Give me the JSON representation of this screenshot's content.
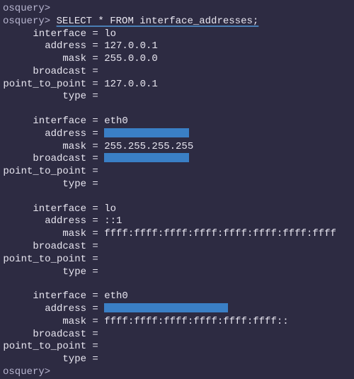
{
  "prompt": "osquery>",
  "query": "SELECT * FROM interface_addresses;",
  "field_labels": {
    "interface": "interface",
    "address": "address",
    "mask": "mask",
    "broadcast": "broadcast",
    "point_to_point": "point_to_point",
    "type": "type"
  },
  "records": [
    {
      "interface": "lo",
      "address": "127.0.0.1",
      "mask": "255.0.0.0",
      "broadcast": "",
      "point_to_point": "127.0.0.1",
      "type": ""
    },
    {
      "interface": "eth0",
      "address_redacted": true,
      "mask": "255.255.255.255",
      "broadcast_redacted": true,
      "point_to_point": "",
      "type": ""
    },
    {
      "interface": "lo",
      "address": "::1",
      "mask": "ffff:ffff:ffff:ffff:ffff:ffff:ffff:ffff",
      "broadcast": "",
      "point_to_point": "",
      "type": ""
    },
    {
      "interface": "eth0",
      "address_redacted": true,
      "mask": "ffff:ffff:ffff:ffff:ffff:ffff::",
      "broadcast": "",
      "point_to_point": "",
      "type": ""
    }
  ]
}
